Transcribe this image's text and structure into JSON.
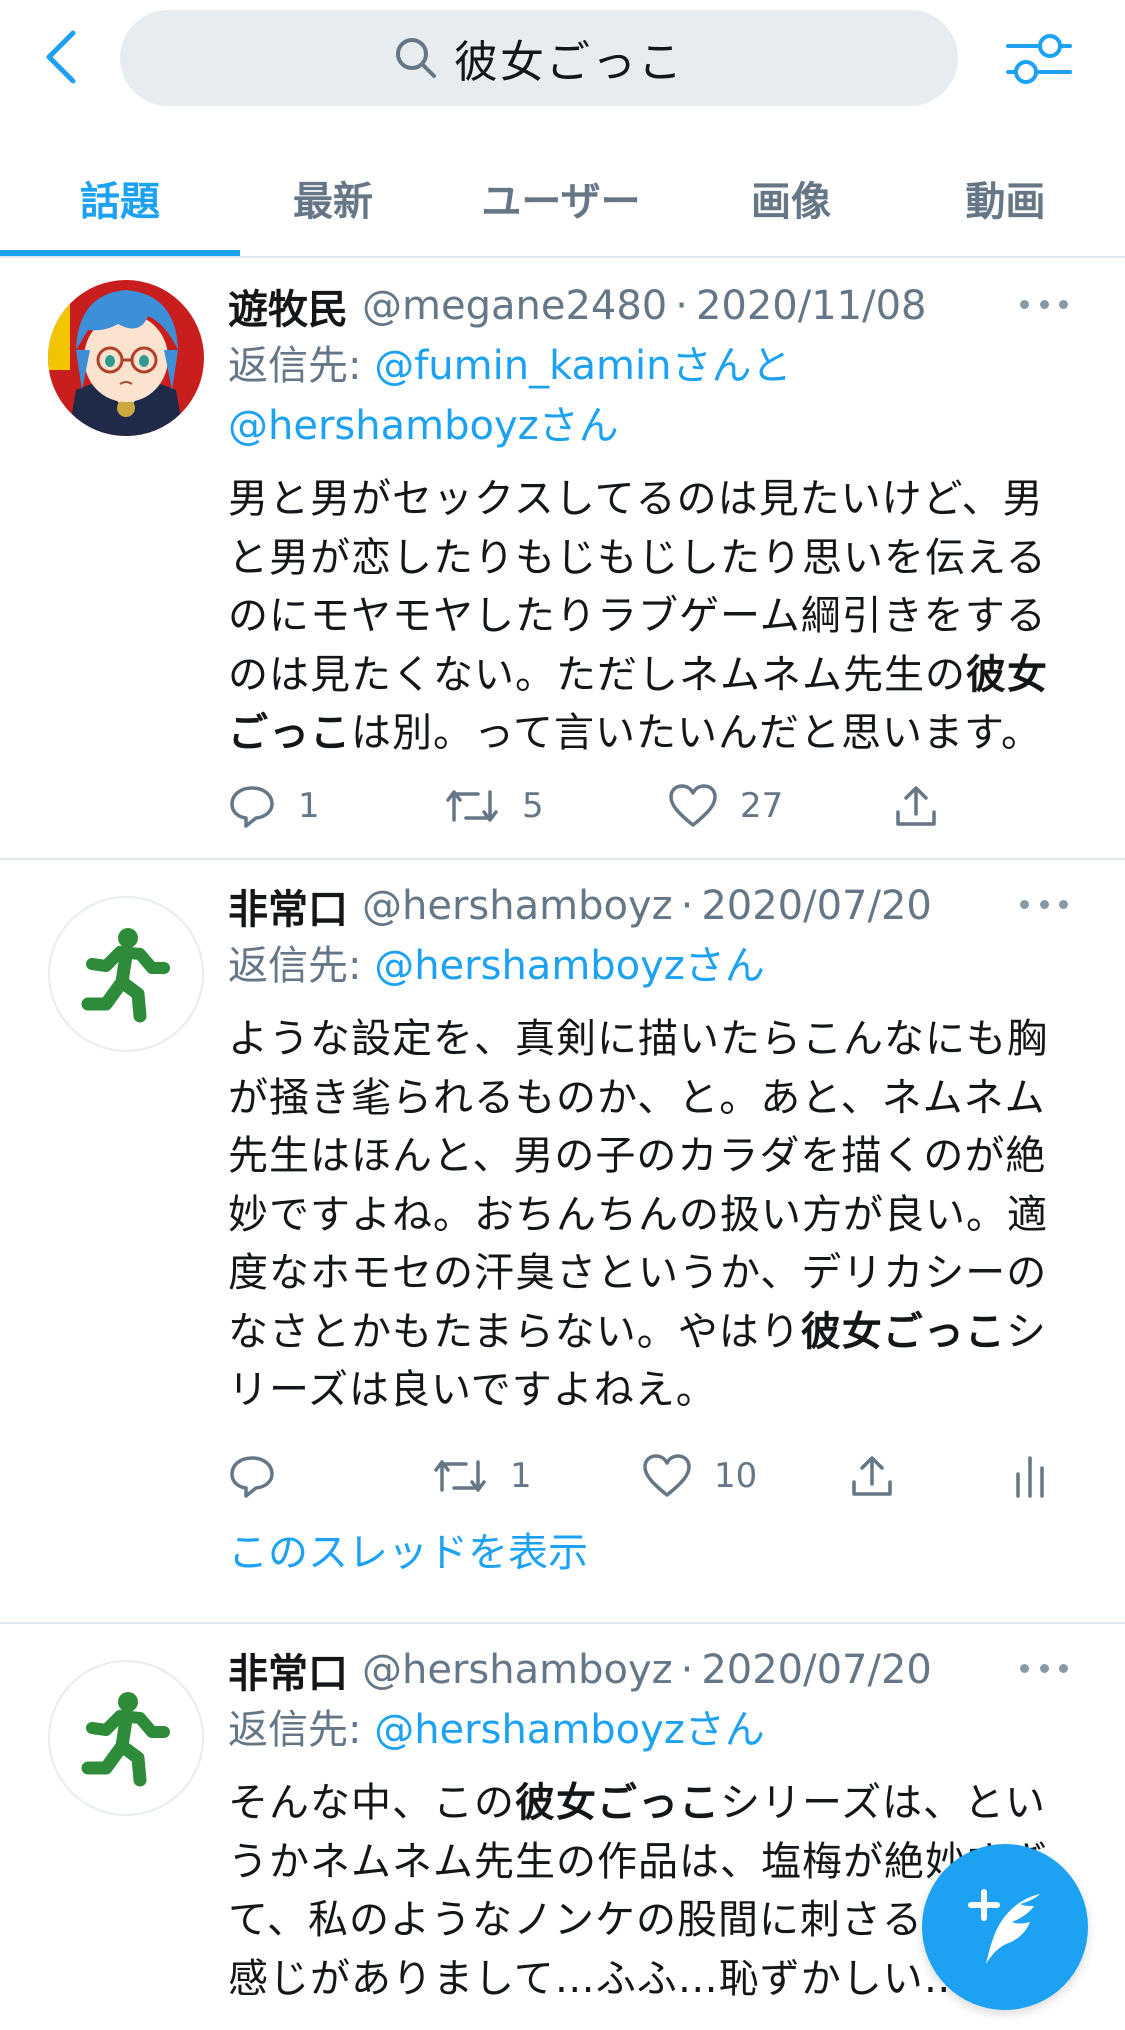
{
  "search": {
    "query": "彼女ごっこ"
  },
  "tabs": [
    {
      "label": "話題"
    },
    {
      "label": "最新"
    },
    {
      "label": "ユーザー"
    },
    {
      "label": "画像"
    },
    {
      "label": "動画"
    }
  ],
  "tweets": [
    {
      "name": "遊牧民",
      "handle": "@megane2480",
      "sep": "·",
      "date": "2020/11/08",
      "reply_prefix": "返信先: ",
      "reply_mention_1": "@fumin_kaminさんと",
      "reply_mention_2": "@hershamboyzさん",
      "text_1": "男と男がセックスしてるのは見たいけど、男と男が恋したりもじもじしたり思いを伝えるのにモヤモヤしたりラブゲーム綱引きをするのは見たくない。ただしネムネム先生の",
      "text_bold": "彼女ごっこ",
      "text_2": "は別。って言いたいんだと思います。",
      "replies": "1",
      "retweets": "5",
      "likes": "27"
    },
    {
      "name": "非常口",
      "handle": "@hershamboyz",
      "sep": "·",
      "date": "2020/07/20",
      "reply_prefix": "返信先: ",
      "reply_mention_1": "@hershamboyzさん",
      "text_1": "ような設定を、真剣に描いたらこんなにも胸が掻き毟られるものか、と。あと、ネムネム先生はほんと、男の子のカラダを描くのが絶妙ですよね。おちんちんの扱い方が良い。適度なホモセの汗臭さというか、デリカシーのなさとかもたまらない。やはり",
      "text_bold": "彼女ごっこ",
      "text_2": "シリーズは良いですよねえ。",
      "replies": "",
      "retweets": "1",
      "likes": "10",
      "thread_link": "このスレッドを表示"
    },
    {
      "name": "非常口",
      "handle": "@hershamboyz",
      "sep": "·",
      "date": "2020/07/20",
      "reply_prefix": "返信先: ",
      "reply_mention_1": "@hershamboyzさん",
      "text_1": "そんな中、この",
      "text_bold": "彼女ごっこ",
      "text_2": "シリーズは、というかネムネム先生の作品は、塩梅が絶妙すぎて、私のようなノンケの股間に刺さるエロの感じがありまして…ふふ…恥ずかしい…"
    }
  ],
  "colors": {
    "accent": "#1da1f2",
    "muted": "#657786",
    "text": "#14171a",
    "divider": "#e1e8ed",
    "exit_green": "#2e8b3a"
  },
  "icons": [
    "back-arrow-icon",
    "search-icon",
    "filter-sliders-icon",
    "more-dots-icon",
    "reply-icon",
    "retweet-icon",
    "like-icon",
    "share-icon",
    "analytics-icon",
    "compose-tweet-icon"
  ]
}
